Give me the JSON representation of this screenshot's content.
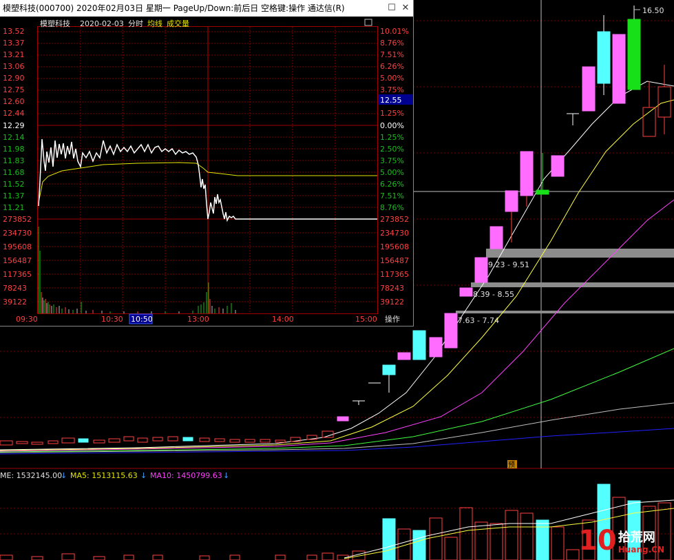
{
  "popup": {
    "title": "模塑科技(000700) 2020年02月03日 星期一 PageUp/Down:前后日 空格键:操作 通达信(R)",
    "header_name": "模塑科技",
    "header_date": "2020-02-03",
    "header_mode": "分时",
    "legend_avg": "均线",
    "legend_vol": "成交量",
    "restore_icon": "restore-icon",
    "close_icon": "close-icon",
    "price_labels_red": [
      "13.52",
      "13.37",
      "13.21",
      "13.06",
      "12.90",
      "12.75",
      "12.60",
      "12.44"
    ],
    "price_base": "12.29",
    "price_labels_green": [
      "12.14",
      "11.98",
      "11.83",
      "11.68",
      "11.52",
      "11.37",
      "11.21"
    ],
    "pct_labels_red": [
      "10.01%",
      "8.76%",
      "7.51%",
      "6.26%",
      "5.00%",
      "3.75%",
      "",
      "1.25%"
    ],
    "pct_base": "0.00%",
    "pct_labels_green": [
      "1.25%",
      "2.50%",
      "3.75%",
      "5.00%",
      "6.26%",
      "7.51%",
      "8.76%"
    ],
    "current_price": "12.55",
    "volume_labels": [
      "273852",
      "234730",
      "195608",
      "156487",
      "117365",
      "78243",
      "39122"
    ],
    "time_labels": [
      "09:30",
      "10:30",
      "10:50",
      "13:00",
      "14:00",
      "15:00"
    ],
    "operate_label": "操作"
  },
  "main": {
    "high_label": "16.50",
    "zone_labels": [
      "9.23 - 9.51",
      "8.39 - 8.55",
      "7.63 - 7.74"
    ],
    "marker_label": "预",
    "indicator": {
      "vol_label": "ME: 1532145.00",
      "ma5_label": "MA5: 1513115.63",
      "ma10_label": "MA10: 1450799.63"
    }
  },
  "watermark": {
    "number": "10",
    "cn": "拾荒网",
    "en": "Huang.CN"
  },
  "colors": {
    "up": "#ff4040",
    "down_fill": "#54ffff",
    "limit_up_fill": "#ff6cff",
    "avg_line": "#e6e600",
    "ma5": "#ffffff",
    "ma10": "#ffff40",
    "ma20": "#ff40ff",
    "ma60": "#40ff40",
    "ma120": "#c0c0c0",
    "ma250": "#2020ff"
  }
}
